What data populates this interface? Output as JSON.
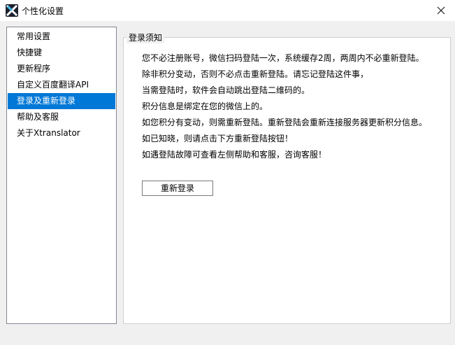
{
  "window": {
    "title": "个性化设置",
    "icon": "xtranslator-logo-icon",
    "close_glyph": "✕"
  },
  "sidebar": {
    "items": [
      {
        "label": "常用设置",
        "selected": false
      },
      {
        "label": "快捷键",
        "selected": false
      },
      {
        "label": "更新程序",
        "selected": false
      },
      {
        "label": "自定义百度翻译API",
        "selected": false
      },
      {
        "label": "登录及重新登录",
        "selected": true
      },
      {
        "label": "帮助及客服",
        "selected": false
      },
      {
        "label": "关于Xtranslator",
        "selected": false
      }
    ]
  },
  "panel": {
    "group_title": "登录须知",
    "lines": [
      "您不必注册账号，微信扫码登陆一次，系统缓存2周，两周内不必重新登陆。",
      "除非积分变动，否则不必点击重新登陆。请忘记登陆这件事，",
      "当需登陆时，软件会自动跳出登陆二维码的。",
      "积分信息是绑定在您的微信上的。",
      "如您积分有变动，则需重新登陆。重新登陆会重新连接服务器更新积分信息。",
      "如已知晓，则请点击下方重新登陆按钮！",
      "如遇登陆故障可查看左侧帮助和客服，咨询客服！"
    ],
    "relogin_button": "重新登录"
  },
  "colors": {
    "selection": "#0078d7",
    "window_bg": "#f0f0f0",
    "panel_bg": "#ffffff"
  }
}
